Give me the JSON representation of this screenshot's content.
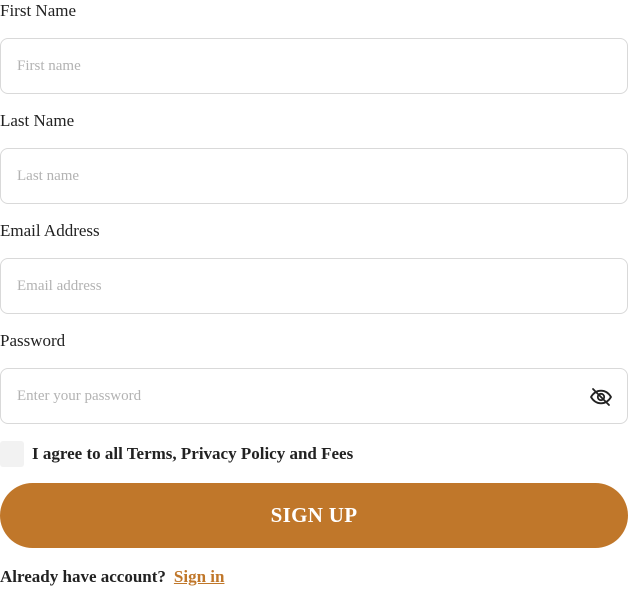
{
  "form": {
    "first_name": {
      "label": "First Name",
      "placeholder": "First name",
      "value": ""
    },
    "last_name": {
      "label": "Last Name",
      "placeholder": "Last name",
      "value": ""
    },
    "email": {
      "label": "Email Address",
      "placeholder": "Email address",
      "value": ""
    },
    "password": {
      "label": "Password",
      "placeholder": "Enter your password",
      "value": "",
      "toggle_icon": "eye-off-icon"
    },
    "agree": {
      "checked": false,
      "text": "I agree to all Terms, Privacy Policy and Fees"
    },
    "submit_label": "SIGN UP",
    "account_prompt": "Already have account?",
    "signin_label": "Sign in"
  },
  "colors": {
    "accent": "#c0772a",
    "text": "#222222",
    "placeholder": "#b3b3b3",
    "border": "#d9d9d9",
    "checkbox_bg": "#f2f2f2"
  }
}
